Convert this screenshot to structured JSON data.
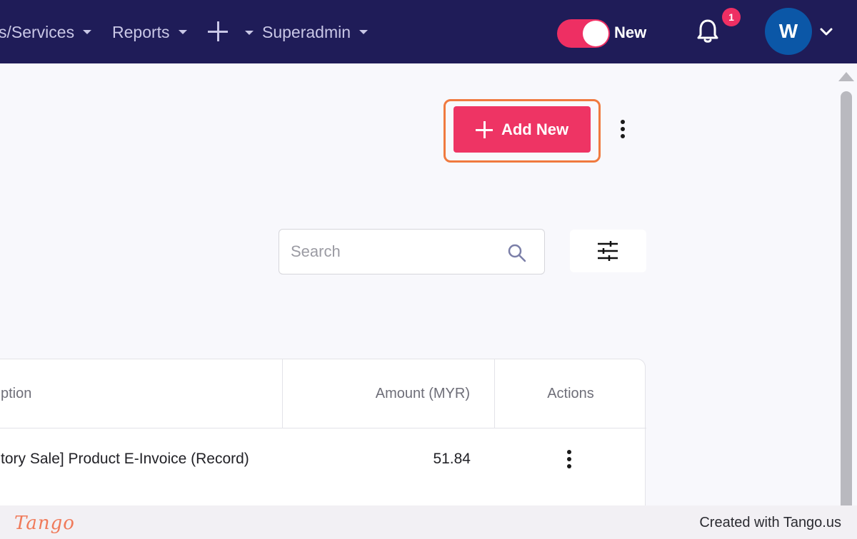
{
  "nav": {
    "items": [
      "s/Services",
      "Reports",
      "Superadmin"
    ],
    "toggle_label": "New",
    "notification_count": "1",
    "avatar_initial": "W"
  },
  "toolbar": {
    "add_new_label": "Add New"
  },
  "search": {
    "placeholder": "Search"
  },
  "table": {
    "columns": [
      "ption",
      "Amount (MYR)",
      "Actions"
    ],
    "rows": [
      {
        "description": "tory Sale] Product E-Invoice (Record)",
        "amount": "51.84"
      }
    ]
  },
  "footer": {
    "logo_text": "Tango",
    "credit": "Created with Tango.us"
  },
  "colors": {
    "nav_bg": "#1f1c58",
    "accent": "#ee3464",
    "highlight": "#f07a3f",
    "avatar_bg": "#0b57a7"
  }
}
